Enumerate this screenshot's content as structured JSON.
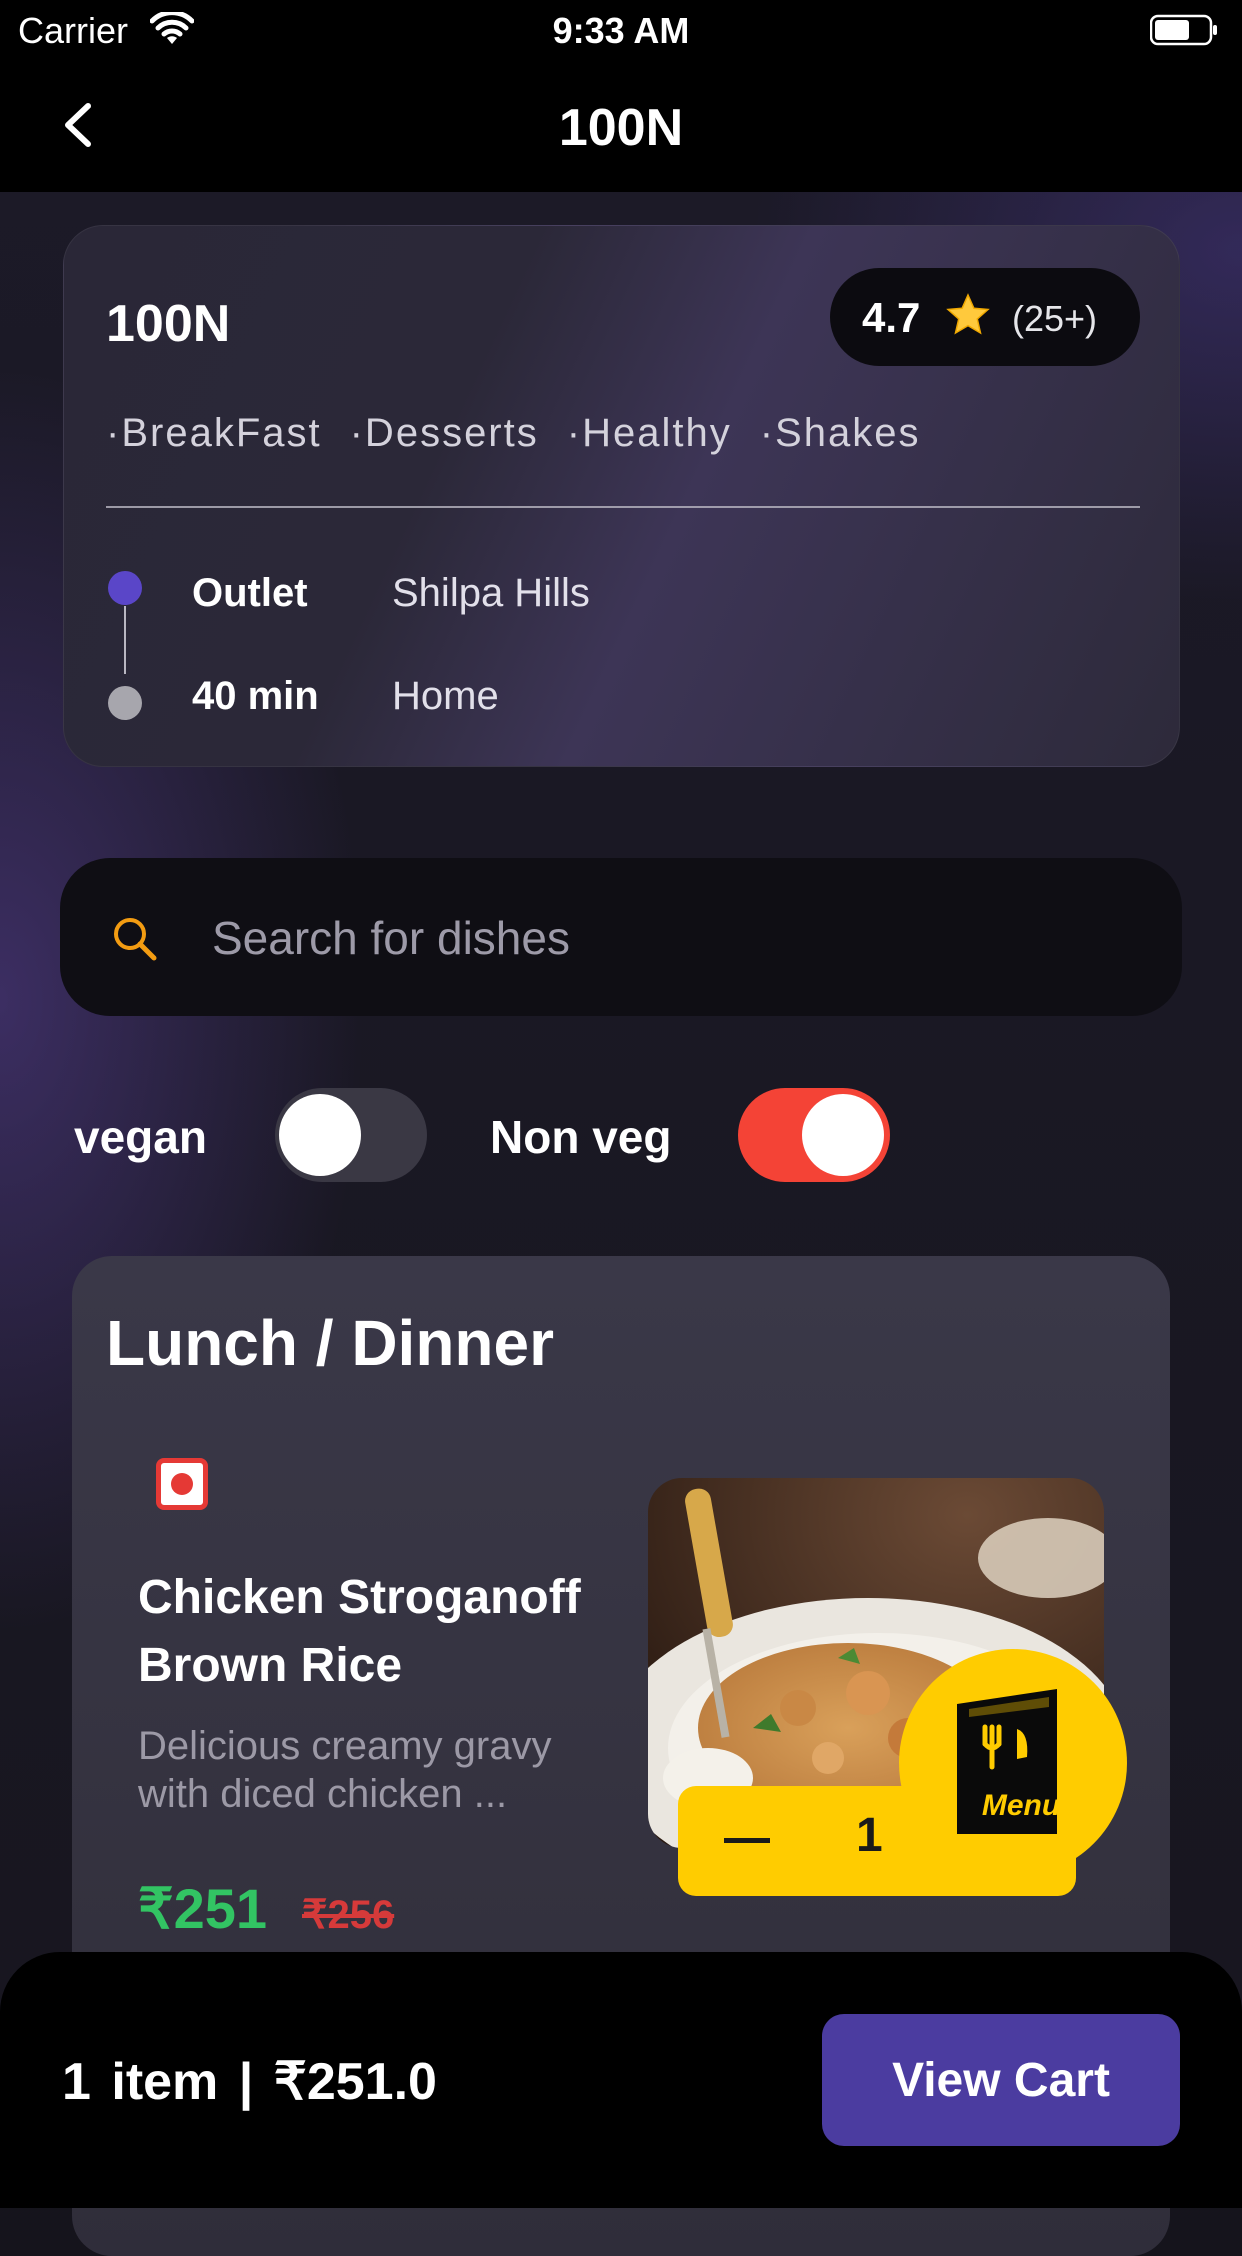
{
  "status_bar": {
    "carrier": "Carrier",
    "time": "9:33 AM"
  },
  "nav": {
    "title": "100N",
    "back_icon": "chevron-left-icon"
  },
  "restaurant": {
    "name": "100N",
    "rating": "4.7",
    "rating_count": "(25+)",
    "tags": [
      "·BreakFast",
      "·Desserts",
      "·Healthy",
      "·Shakes"
    ],
    "outlet_label": "Outlet",
    "outlet_value": "Shilpa Hills",
    "eta_label": "40 min",
    "eta_value": "Home"
  },
  "search": {
    "placeholder": "Search for dishes",
    "value": ""
  },
  "filters": {
    "vegan": {
      "label": "vegan",
      "on": false
    },
    "non_veg": {
      "label": "Non veg",
      "on": true,
      "color": "#f44336"
    }
  },
  "menu": {
    "section_title": "Lunch / Dinner",
    "items": [
      {
        "name": "Chicken Stroganoff Brown Rice",
        "description": "Delicious creamy gravy with diced chicken ...",
        "price": "₹251",
        "original_price": "₹256",
        "quantity": "1",
        "type": "non-veg"
      }
    ]
  },
  "menu_fab": {
    "label": "Menu",
    "icon": "restaurant-menu-icon"
  },
  "cart": {
    "summary": "1 item | ₹251.0",
    "button_label": "View Cart"
  },
  "colors": {
    "accent": "#4b3ca0",
    "price_green": "#32c463",
    "strike_red": "#d63a3a",
    "yellow": "#ffcc00"
  }
}
